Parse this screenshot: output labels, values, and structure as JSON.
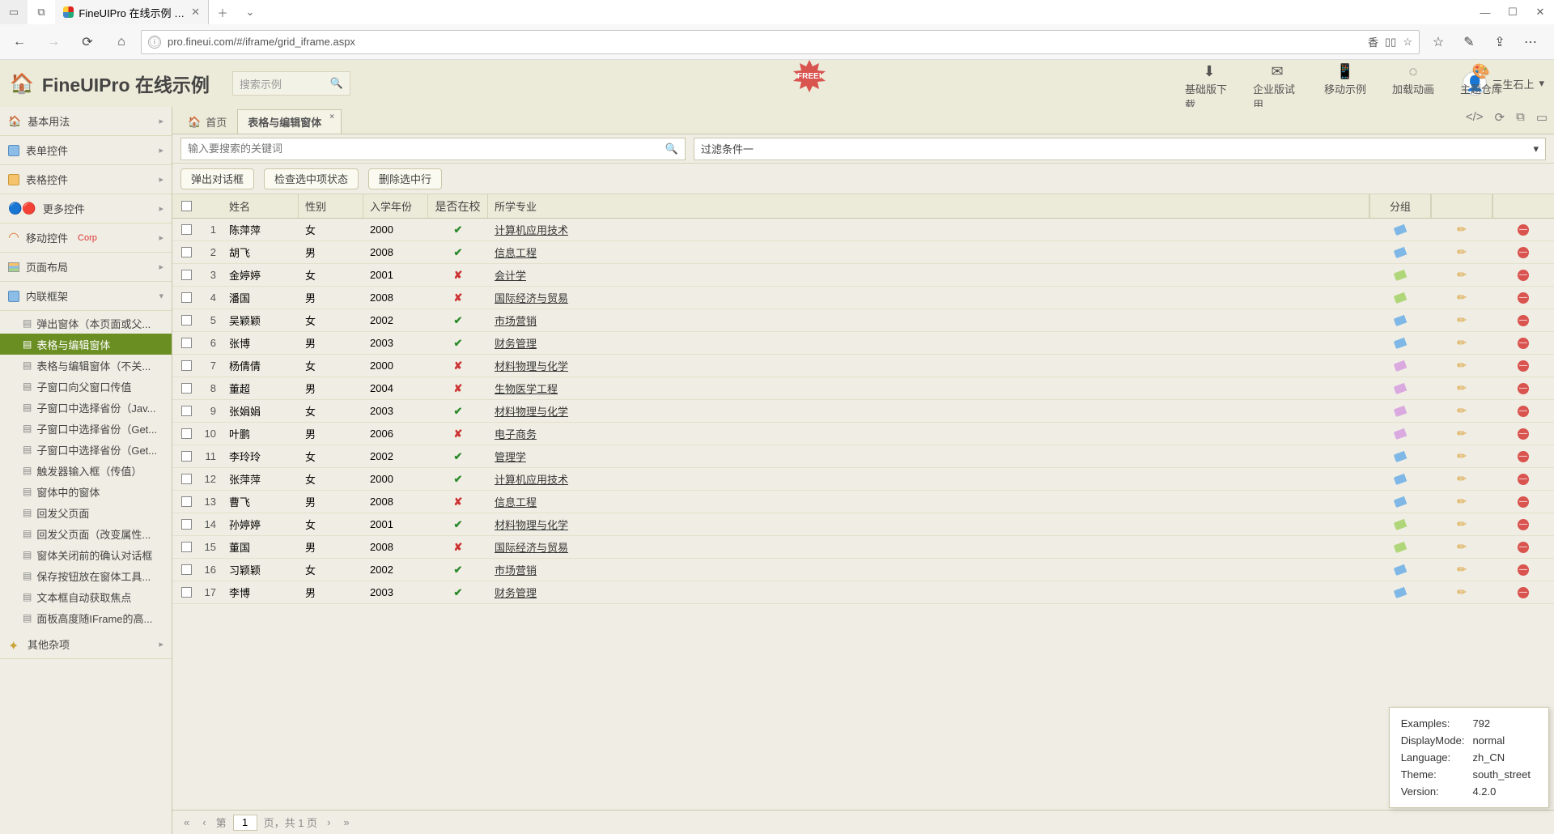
{
  "os": {
    "tabTitle": "FineUIPro 在线示例 - 基"
  },
  "browser": {
    "url": "pro.fineui.com/#/iframe/grid_iframe.aspx"
  },
  "appHeader": {
    "title": "FineUIPro 在线示例",
    "searchPlaceholder": "搜索示例",
    "free": "FREE!",
    "links": [
      {
        "icon": "⬇",
        "label": "基础版下载"
      },
      {
        "icon": "✉",
        "label": "企业版试用"
      },
      {
        "icon": "📱",
        "label": "移动示例"
      },
      {
        "icon": "◌",
        "label": "加载动画"
      },
      {
        "icon": "🎨",
        "label": "主题仓库"
      }
    ],
    "user": "三生石上"
  },
  "accordions": [
    {
      "icon": "home",
      "label": "基本用法",
      "expanded": false
    },
    {
      "icon": "form",
      "label": "表单控件",
      "expanded": false
    },
    {
      "icon": "grid",
      "label": "表格控件",
      "expanded": false
    },
    {
      "icon": "more",
      "label": "更多控件",
      "expanded": false
    },
    {
      "icon": "mobile",
      "label": "移动控件",
      "corp": "Corp",
      "expanded": false
    },
    {
      "icon": "layout",
      "label": "页面布局",
      "expanded": false
    },
    {
      "icon": "iframe",
      "label": "内联框架",
      "expanded": true
    }
  ],
  "treeItems": [
    "弹出窗体（本页面或父...",
    "表格与编辑窗体",
    "表格与编辑窗体（不关...",
    "子窗口向父窗口传值",
    "子窗口中选择省份（Jav...",
    "子窗口中选择省份（Get...",
    "子窗口中选择省份（Get...",
    "触发器输入框（传值）",
    "窗体中的窗体",
    "回发父页面",
    "回发父页面（改变属性...",
    "窗体关闭前的确认对话框",
    "保存按钮放在窗体工具...",
    "文本框自动获取焦点",
    "面板高度随IFrame的高..."
  ],
  "treeActiveIndex": 1,
  "lastAccordion": {
    "label": "其他杂项"
  },
  "contentTabs": {
    "home": "首页",
    "active": "表格与编辑窗体"
  },
  "filter": {
    "searchPlaceholder": "输入要搜索的关键词",
    "combo": "过滤条件一"
  },
  "buttons": {
    "dialog": "弹出对话框",
    "check": "检查选中项状态",
    "del": "删除选中行"
  },
  "columns": {
    "name": "姓名",
    "gender": "性别",
    "year": "入学年份",
    "atschool": "是否在校",
    "major": "所学专业",
    "group": "分组"
  },
  "rows": [
    {
      "n": 1,
      "name": "陈萍萍",
      "g": "女",
      "y": "2000",
      "at": true,
      "major": "计算机应用技术",
      "tag": 0
    },
    {
      "n": 2,
      "name": "胡飞",
      "g": "男",
      "y": "2008",
      "at": true,
      "major": "信息工程",
      "tag": 0
    },
    {
      "n": 3,
      "name": "金婷婷",
      "g": "女",
      "y": "2001",
      "at": false,
      "major": "会计学",
      "tag": 1
    },
    {
      "n": 4,
      "name": "潘国",
      "g": "男",
      "y": "2008",
      "at": false,
      "major": "国际经济与贸易",
      "tag": 1
    },
    {
      "n": 5,
      "name": "吴颖颖",
      "g": "女",
      "y": "2002",
      "at": true,
      "major": "市场营销",
      "tag": 0
    },
    {
      "n": 6,
      "name": "张博",
      "g": "男",
      "y": "2003",
      "at": true,
      "major": "财务管理",
      "tag": 0
    },
    {
      "n": 7,
      "name": "杨倩倩",
      "g": "女",
      "y": "2000",
      "at": false,
      "major": "材料物理与化学",
      "tag": 2
    },
    {
      "n": 8,
      "name": "董超",
      "g": "男",
      "y": "2004",
      "at": false,
      "major": "生物医学工程",
      "tag": 2
    },
    {
      "n": 9,
      "name": "张娟娟",
      "g": "女",
      "y": "2003",
      "at": true,
      "major": "材料物理与化学",
      "tag": 2
    },
    {
      "n": 10,
      "name": "叶鹏",
      "g": "男",
      "y": "2006",
      "at": false,
      "major": "电子商务",
      "tag": 2
    },
    {
      "n": 11,
      "name": "李玲玲",
      "g": "女",
      "y": "2002",
      "at": true,
      "major": "管理学",
      "tag": 0
    },
    {
      "n": 12,
      "name": "张萍萍",
      "g": "女",
      "y": "2000",
      "at": true,
      "major": "计算机应用技术",
      "tag": 0
    },
    {
      "n": 13,
      "name": "曹飞",
      "g": "男",
      "y": "2008",
      "at": false,
      "major": "信息工程",
      "tag": 0
    },
    {
      "n": 14,
      "name": "孙婷婷",
      "g": "女",
      "y": "2001",
      "at": true,
      "major": "材料物理与化学",
      "tag": 1
    },
    {
      "n": 15,
      "name": "董国",
      "g": "男",
      "y": "2008",
      "at": false,
      "major": "国际经济与贸易",
      "tag": 1
    },
    {
      "n": 16,
      "name": "习颖颖",
      "g": "女",
      "y": "2002",
      "at": true,
      "major": "市场营销",
      "tag": 0
    },
    {
      "n": 17,
      "name": "李博",
      "g": "男",
      "y": "2003",
      "at": true,
      "major": "财务管理",
      "tag": 0
    }
  ],
  "pager": {
    "preA": "第",
    "page": "1",
    "postA": "页，共 1 页"
  },
  "diag": {
    "r1k": "Examples:",
    "r1v": "792",
    "r2k": "DisplayMode:",
    "r2v": "normal",
    "r3k": "Language:",
    "r3v": "zh_CN",
    "r4k": "Theme:",
    "r4v": "south_street",
    "r5k": "Version:",
    "r5v": "4.2.0"
  }
}
